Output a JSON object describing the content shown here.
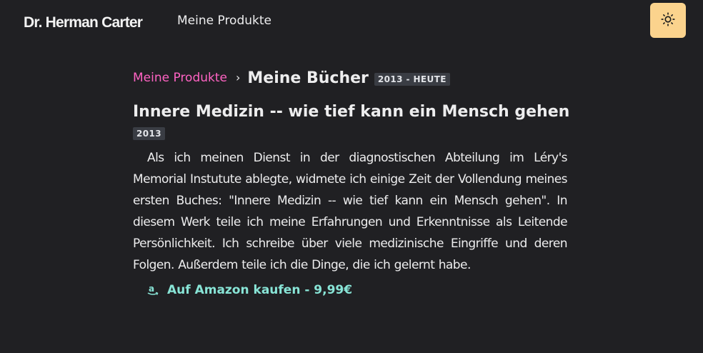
{
  "header": {
    "brand": "Dr. Herman Carter",
    "nav_link": "Meine Produkte",
    "theme_toggle_icon": "sun-icon",
    "toggle_color": "#fbd38d"
  },
  "breadcrumb": {
    "parent": "Meine Produkte",
    "separator": "›",
    "current": "Meine Bücher",
    "badge": "2013 - HEUTE"
  },
  "book": {
    "title": "Innere Medizin -- wie tief kann ein Mensch gehen",
    "year": "2013",
    "description": "Als ich meinen Dienst in der diagnostischen Abteilung im Léry's Memorial Instutute ablegte, widmete ich einige Zeit der Vollendung meines ersten Buches: \"Innere Medizin -- wie tief kann ein Mensch gehen\". In diesem Werk teile ich meine Erfahrungen und Erkenntnisse als Leitende Persönlichkeit. Ich schreibe über viele medizinische Eingriffe und deren Folgen. Außerdem teile ich die Dinge, die ich gelernt habe.",
    "buy_icon": "amazon-icon",
    "buy_label": "Auf Amazon kaufen - 9,99€"
  },
  "colors": {
    "background": "#202023",
    "link_pink": "#ff63c3",
    "link_teal": "#88e4d6",
    "badge_bg": "#3a3d44"
  }
}
